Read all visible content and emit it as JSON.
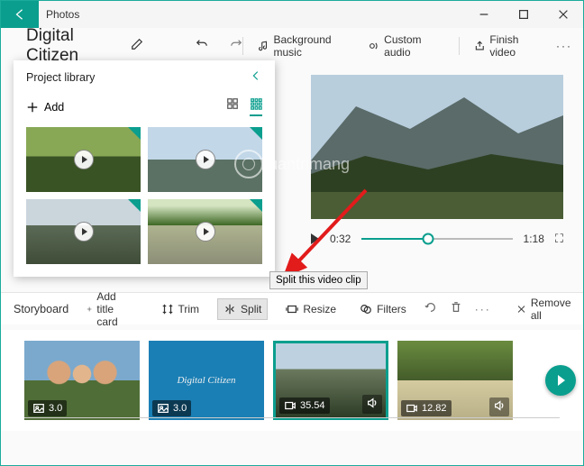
{
  "app": {
    "title": "Photos"
  },
  "project": {
    "title": "Digital Citizen"
  },
  "toolbar": {
    "bg_music": "Background music",
    "custom_audio": "Custom audio",
    "finish": "Finish video"
  },
  "library": {
    "title": "Project library",
    "add": "Add"
  },
  "player": {
    "current": "0:32",
    "total": "1:18"
  },
  "tooltip": {
    "split": "Split this video clip"
  },
  "storyboard": {
    "title": "Storyboard",
    "add_title": "Add title card",
    "trim": "Trim",
    "split": "Split",
    "resize": "Resize",
    "filters": "Filters",
    "remove_all": "Remove all"
  },
  "clips": {
    "c1": "3.0",
    "c2": "3.0",
    "c2_text": "Digital Citizen",
    "c3": "35.54",
    "c4": "12.82"
  },
  "watermark": {
    "text": "uantrimang"
  }
}
